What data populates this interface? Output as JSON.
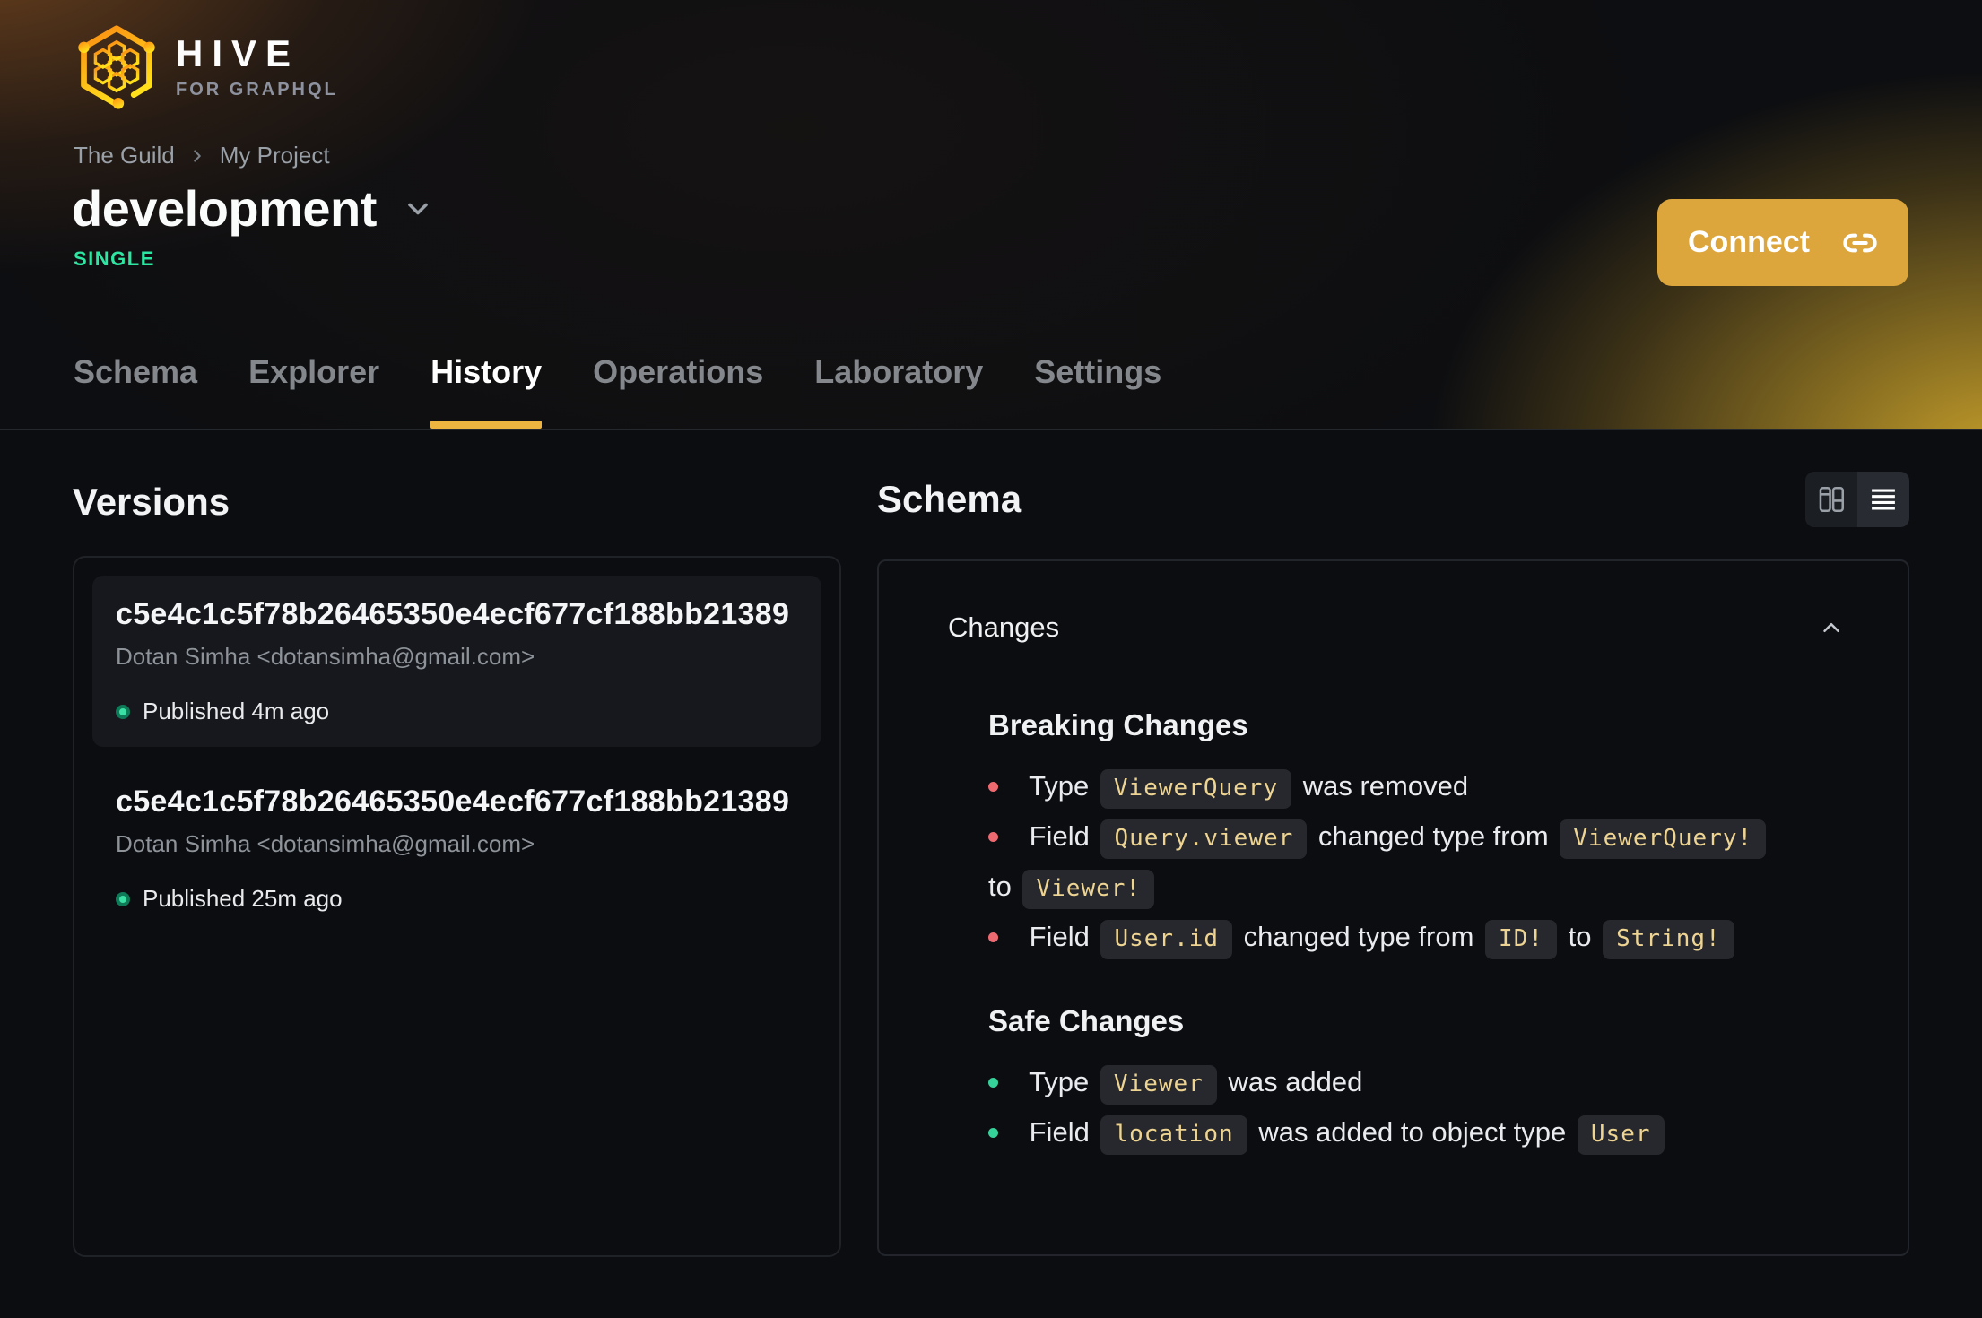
{
  "colors": {
    "accent_yellow": "#EEB440",
    "connect_button": "#DCA63D",
    "badge_green": "#2EE5A2",
    "breaking_red": "#EE6A70",
    "safe_green": "#35D29A",
    "code_text": "#EED492",
    "page_background": "#0B0D11"
  },
  "icons": {
    "logo": "hive-hexagon-icon",
    "breadcrumb_separator": "chevron-right-icon",
    "target_selector": "chevron-down-icon",
    "connect": "link-icon",
    "view_columns": "columns-view-icon",
    "view_list": "list-view-icon",
    "collapse": "chevron-up-icon",
    "published": "green-dot-icon"
  },
  "header": {
    "logo": {
      "title": "HIVE",
      "subtitle": "FOR GRAPHQL"
    },
    "breadcrumb": [
      "The Guild",
      "My Project"
    ],
    "target_name": "development",
    "badge": "SINGLE",
    "connect_label": "Connect",
    "tabs": [
      {
        "label": "Schema",
        "active": false
      },
      {
        "label": "Explorer",
        "active": false
      },
      {
        "label": "History",
        "active": true
      },
      {
        "label": "Operations",
        "active": false
      },
      {
        "label": "Laboratory",
        "active": false
      },
      {
        "label": "Settings",
        "active": false
      }
    ]
  },
  "versions": {
    "title": "Versions",
    "items": [
      {
        "hash": "c5e4c1c5f78b26465350e4ecf677cf188bb21389",
        "author": "Dotan Simha <dotansimha@gmail.com>",
        "status": "Published 4m ago",
        "selected": true
      },
      {
        "hash": "c5e4c1c5f78b26465350e4ecf677cf188bb21389",
        "author": "Dotan Simha <dotansimha@gmail.com>",
        "status": "Published 25m ago",
        "selected": false
      }
    ]
  },
  "schema": {
    "title": "Schema",
    "view_modes": [
      "columns",
      "list"
    ],
    "active_view": "list",
    "changes": {
      "title": "Changes",
      "groups": [
        {
          "title": "Breaking Changes",
          "severity": "breaking",
          "items": [
            {
              "parts": [
                {
                  "type": "text",
                  "text": "Type"
                },
                {
                  "type": "code",
                  "text": "ViewerQuery"
                },
                {
                  "type": "text",
                  "text": "was removed"
                }
              ]
            },
            {
              "parts": [
                {
                  "type": "text",
                  "text": "Field"
                },
                {
                  "type": "code",
                  "text": "Query.viewer"
                },
                {
                  "type": "text",
                  "text": "changed type from"
                },
                {
                  "type": "code",
                  "text": "ViewerQuery!"
                },
                {
                  "type": "text",
                  "text": "to"
                },
                {
                  "type": "code",
                  "text": "Viewer!"
                }
              ]
            },
            {
              "parts": [
                {
                  "type": "text",
                  "text": "Field"
                },
                {
                  "type": "code",
                  "text": "User.id"
                },
                {
                  "type": "text",
                  "text": "changed type from"
                },
                {
                  "type": "code",
                  "text": "ID!"
                },
                {
                  "type": "text",
                  "text": "to"
                },
                {
                  "type": "code",
                  "text": "String!"
                }
              ]
            }
          ]
        },
        {
          "title": "Safe Changes",
          "severity": "safe",
          "items": [
            {
              "parts": [
                {
                  "type": "text",
                  "text": "Type"
                },
                {
                  "type": "code",
                  "text": "Viewer"
                },
                {
                  "type": "text",
                  "text": "was added"
                }
              ]
            },
            {
              "parts": [
                {
                  "type": "text",
                  "text": "Field"
                },
                {
                  "type": "code",
                  "text": "location"
                },
                {
                  "type": "text",
                  "text": "was added to object type"
                },
                {
                  "type": "code",
                  "text": "User"
                }
              ]
            }
          ]
        }
      ]
    }
  }
}
